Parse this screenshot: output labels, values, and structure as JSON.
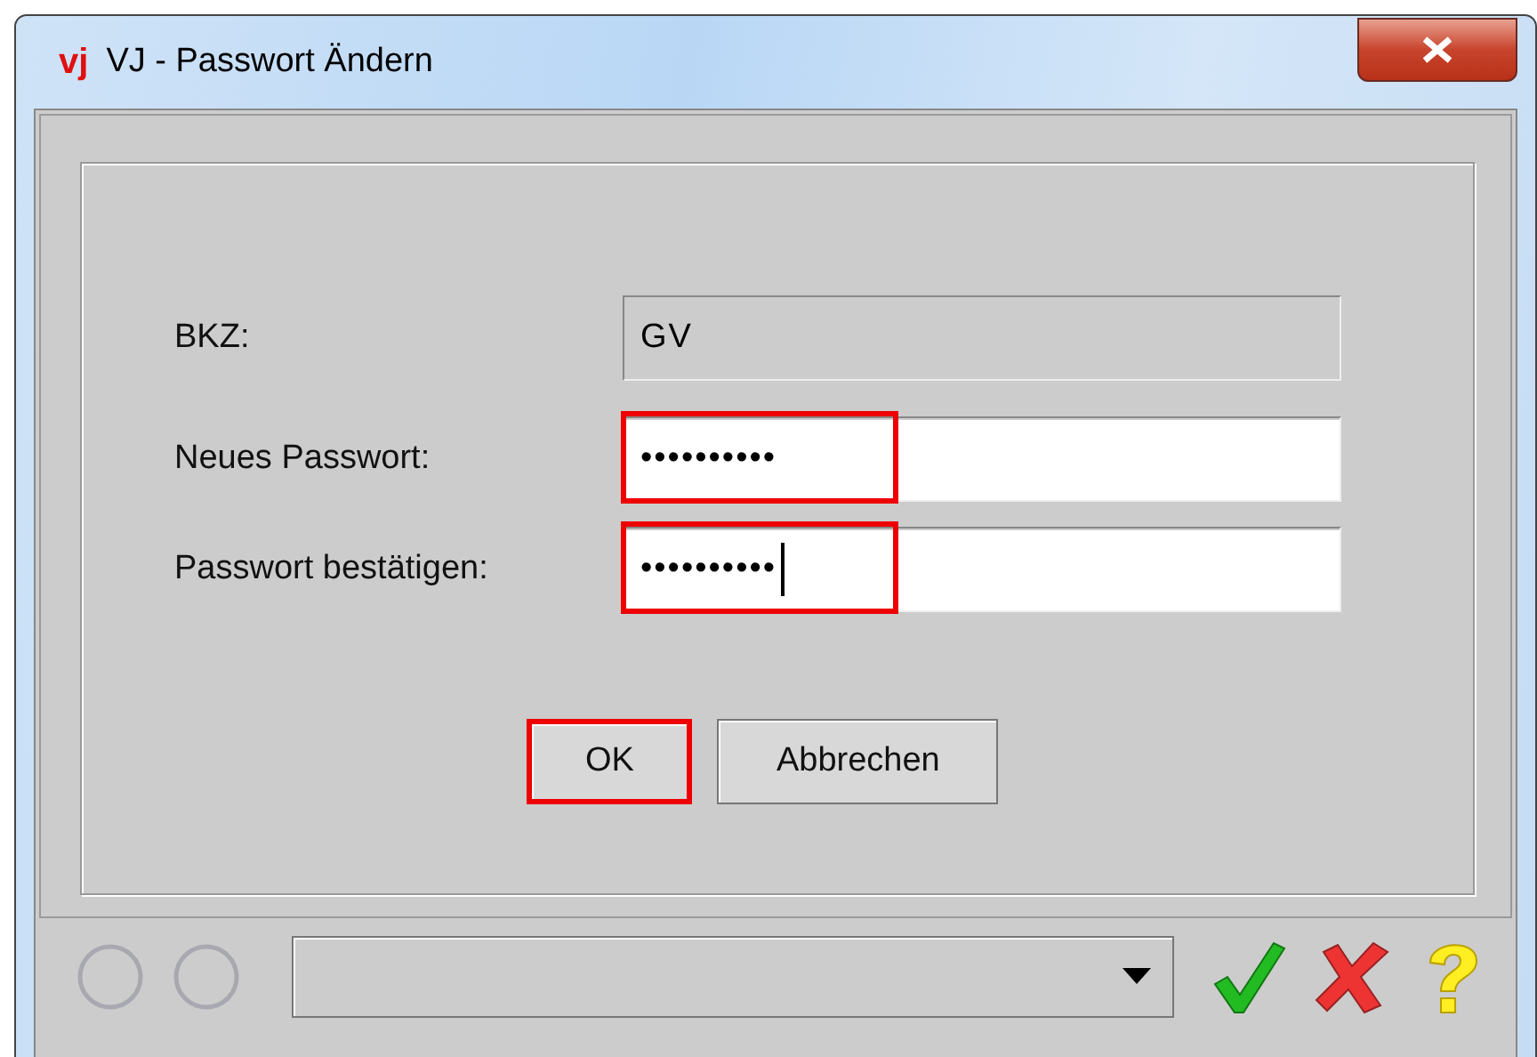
{
  "window": {
    "logo": "vj",
    "title": "VJ - Passwort Ändern"
  },
  "fields": [
    {
      "label": "BKZ:",
      "value": "GV",
      "disabled": true,
      "highlighted": false,
      "focused": false
    },
    {
      "label": "Neues Passwort:",
      "value": "••••••••••",
      "disabled": false,
      "highlighted": true,
      "focused": false
    },
    {
      "label": "Passwort bestätigen:",
      "value": "••••••••••",
      "disabled": false,
      "highlighted": true,
      "focused": true
    }
  ],
  "buttons": [
    {
      "label": "OK",
      "highlighted": true
    },
    {
      "label": "Abbrechen",
      "highlighted": false
    }
  ]
}
